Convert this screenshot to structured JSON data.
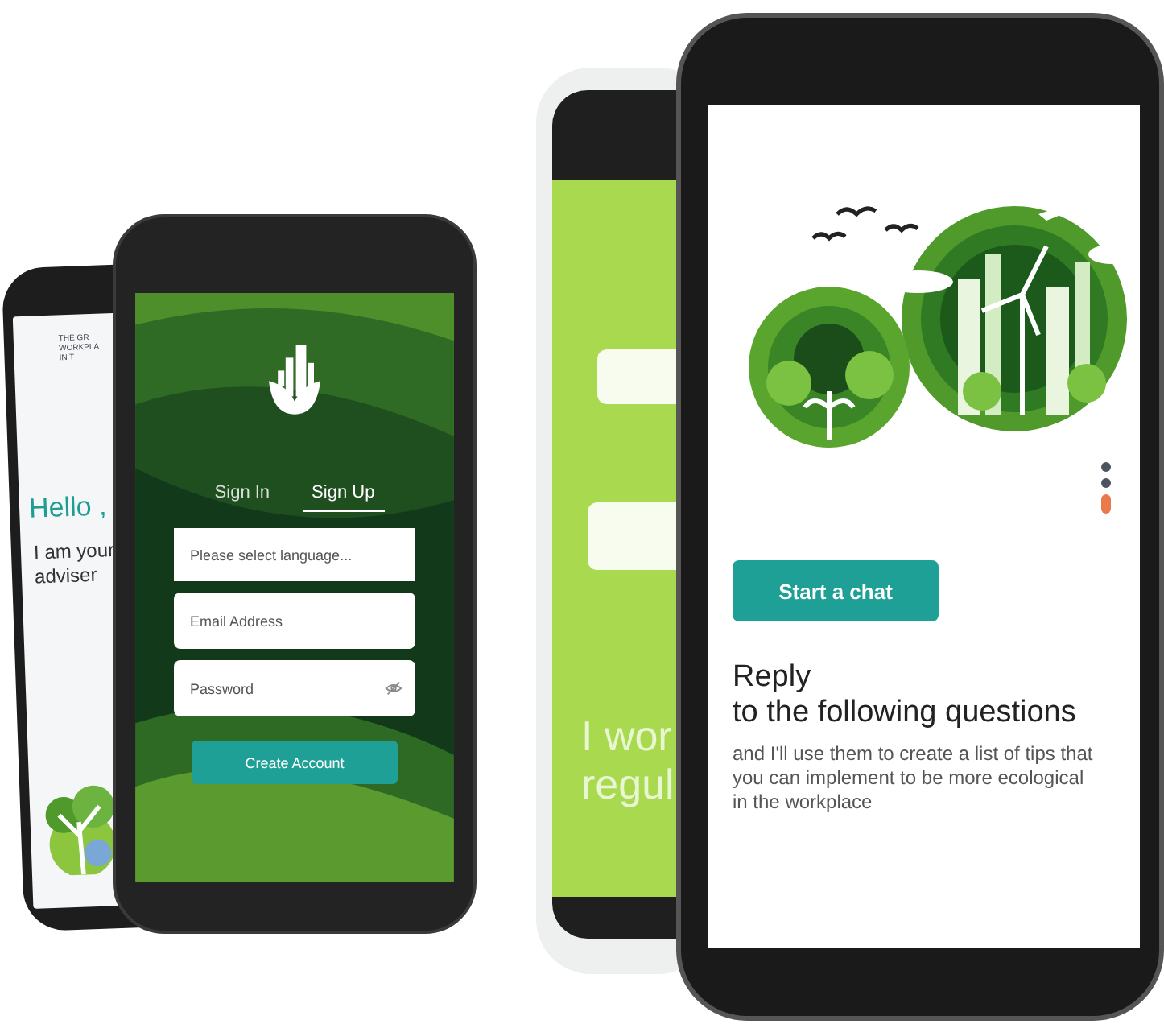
{
  "welcome_phone": {
    "logo_lines": [
      "THE GR",
      "WORKPLA",
      "IN T"
    ],
    "greeting": "Hello ,",
    "intro_lines": [
      "I am your",
      "adviser"
    ]
  },
  "signup_phone": {
    "tabs": [
      {
        "label": "Sign In",
        "selected": false
      },
      {
        "label": "Sign Up",
        "selected": true
      }
    ],
    "fields": [
      {
        "kind": "select",
        "placeholder": "Please select language..."
      },
      {
        "kind": "text",
        "placeholder": "Email Address"
      },
      {
        "kind": "password",
        "placeholder": "Password"
      }
    ],
    "button": "Create Account"
  },
  "chat_phone": {
    "headline_lines": [
      "I wor",
      "regul"
    ]
  },
  "onboarding_phone": {
    "pager": [
      {
        "selected": false
      },
      {
        "selected": false
      },
      {
        "selected": true
      }
    ],
    "button": "Start a chat",
    "title_lines": [
      "Reply",
      "to the following questions"
    ],
    "body": "and I'll use them to create a list of tips that you can implement to be more ecological  in the workplace"
  }
}
